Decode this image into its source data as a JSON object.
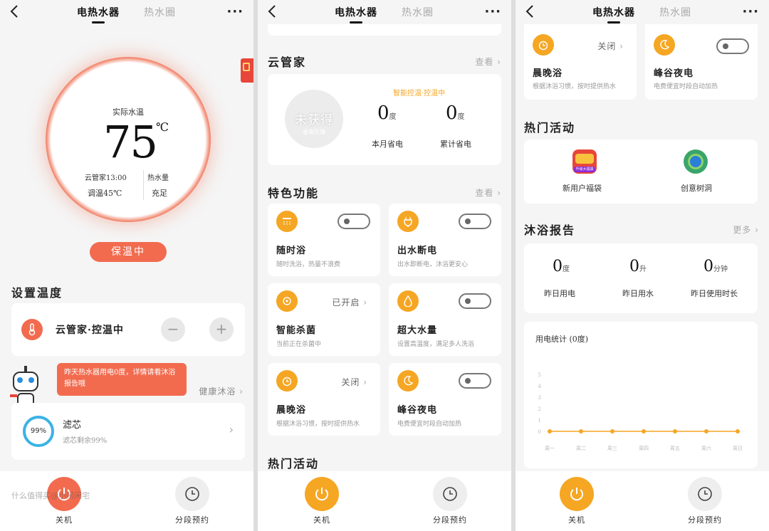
{
  "nav": {
    "tab_active": "电热水器",
    "tab_other": "热水圈"
  },
  "panel1": {
    "gauge": {
      "label": "实际水温",
      "value": "75",
      "unit": "℃",
      "sched": "云管家13:00",
      "setpoint": "调温45℃",
      "hot_label": "热水量",
      "hot_value": "充足"
    },
    "status_pill": "保温中",
    "set_temp_title": "设置温度",
    "temp_control_label": "云管家·控温中",
    "minus": "−",
    "plus": "+",
    "bubble": "昨天热水器用电0度，详情请看沐浴报告哦",
    "health_link": "健康沐浴",
    "filter": {
      "percent": "99%",
      "percent_value": 99,
      "title": "滤芯",
      "desc": "滤芯剩余99%"
    },
    "watermark": "什么值得买@小闲闲宅"
  },
  "panel2": {
    "cloud_title": "云管家",
    "view_more": "查看",
    "badge_main": "未获得",
    "badge_sub": "省电先锋",
    "smart_label": "智能控温·控温中",
    "month_value": "0",
    "month_unit": "度",
    "month_label": "本月省电",
    "total_value": "0",
    "total_unit": "度",
    "total_label": "累计省电",
    "features_title": "特色功能",
    "features": [
      {
        "name": "随时浴",
        "desc": "随时洗浴，热量不浪费",
        "status": ""
      },
      {
        "name": "出水断电",
        "desc": "出水即断电，沐浴更安心",
        "status": ""
      },
      {
        "name": "智能杀菌",
        "desc": "当前正在杀菌中",
        "status": "已开启"
      },
      {
        "name": "超大水量",
        "desc": "设置高温度，满足多人洗浴",
        "status": ""
      },
      {
        "name": "晨晚浴",
        "desc": "根据沐浴习惯，按时提供热水",
        "status": "关闭"
      },
      {
        "name": "峰谷夜电",
        "desc": "电费便宜时段自动加热",
        "status": ""
      }
    ],
    "hot_title": "热门活动"
  },
  "panel3": {
    "morning_name": "晨晚浴",
    "morning_desc": "根据沐浴习惯，按时提供热水",
    "morning_status": "关闭",
    "valley_name": "峰谷夜电",
    "valley_desc": "电费便宜时段自动加热",
    "hot_title": "热门活动",
    "activity1": "新用户福袋",
    "activity1_badge": "升级大福袋",
    "activity2": "创意树洞",
    "report_title": "沐浴报告",
    "report_more": "更多",
    "stats": [
      {
        "value": "0",
        "unit": "度",
        "label": "昨日用电"
      },
      {
        "value": "0",
        "unit": "升",
        "label": "昨日用水"
      },
      {
        "value": "0",
        "unit": "分钟",
        "label": "昨日使用时长"
      }
    ]
  },
  "chart_data": {
    "type": "line",
    "title": "用电统计 (0度)",
    "categories": [
      "周一",
      "周二",
      "周三",
      "周四",
      "周五",
      "周六",
      "周日"
    ],
    "values": [
      0,
      0,
      0,
      0,
      0,
      0,
      0
    ],
    "ylim": [
      0,
      5
    ],
    "yticks": [
      "0",
      "1",
      "2",
      "3",
      "4",
      "5"
    ],
    "color": "#f5a623"
  },
  "bottom": {
    "power_label": "关机",
    "schedule_label": "分段预约"
  },
  "colors": {
    "accent_red": "#f26b4f",
    "accent_orange": "#f5a623",
    "filter_blue": "#3bb3e6"
  }
}
